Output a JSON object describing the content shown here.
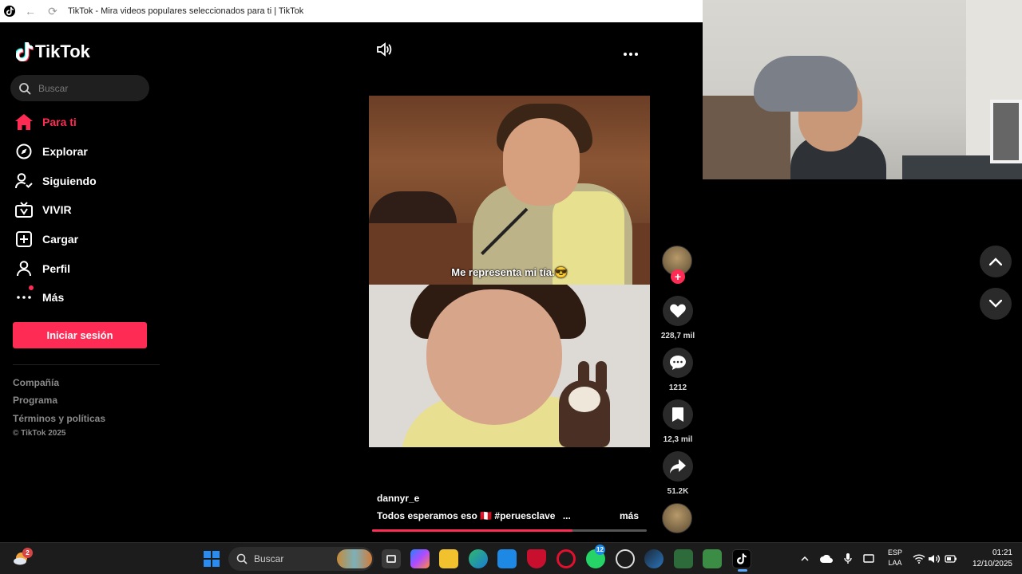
{
  "window": {
    "title": "TikTok - Mira videos populares seleccionados para ti | TikTok"
  },
  "sidebar": {
    "logo_text": "TikTok",
    "search_placeholder": "Buscar",
    "nav": [
      {
        "label": "Para ti",
        "icon": "home-icon",
        "active": true
      },
      {
        "label": "Explorar",
        "icon": "compass-icon",
        "active": false
      },
      {
        "label": "Siguiendo",
        "icon": "following-icon",
        "active": false
      },
      {
        "label": "VIVIR",
        "icon": "live-tv-icon",
        "active": false
      },
      {
        "label": "Cargar",
        "icon": "upload-plus-icon",
        "active": false
      },
      {
        "label": "Perfil",
        "icon": "profile-icon",
        "active": false
      },
      {
        "label": "Más",
        "icon": "more-dots-icon",
        "active": false
      }
    ],
    "login_label": "Iniciar sesión",
    "footer": {
      "links": [
        "Compañía",
        "Programa",
        "Términos y políticas"
      ],
      "copyright": "© TikTok 2025"
    }
  },
  "video": {
    "caption_overlay": "Me representa mi tía.😎",
    "author": "dannyr_e",
    "description": "Todos esperamos eso 🇵🇪 #peruesclave",
    "description_ellipsis": "...",
    "more_label": "más",
    "progress": 0.73
  },
  "actions": {
    "likes": "228,7 mil",
    "comments": "1212",
    "bookmarks": "12,3 mil",
    "shares": "51.2K"
  },
  "taskbar": {
    "search_placeholder": "Buscar",
    "widget_badge": "2",
    "whatsapp_badge": "12",
    "language_line1": "ESP",
    "language_line2": "LAA",
    "time": "01:21",
    "date": "12/10/2025"
  },
  "colors": {
    "accent": "#fe2c55",
    "background": "#000000",
    "taskbar": "#1c1c1c"
  }
}
